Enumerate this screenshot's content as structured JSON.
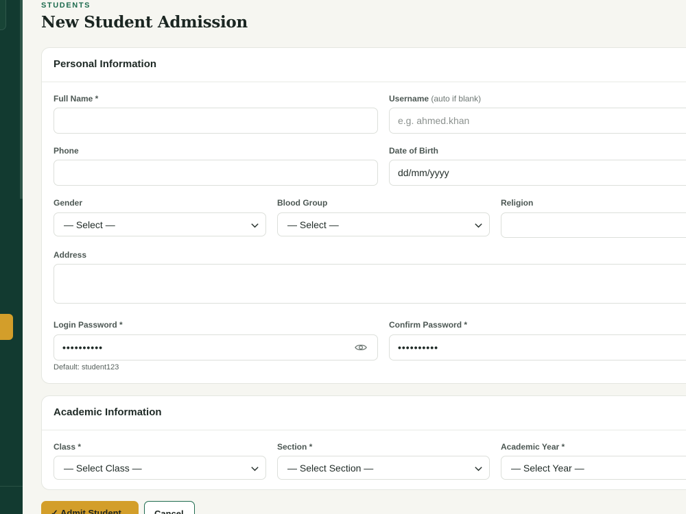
{
  "header": {
    "eyebrow": "STUDENTS",
    "title": "New Student Admission"
  },
  "personal": {
    "title": "Personal Information",
    "full_name": {
      "label": "Full Name *",
      "value": ""
    },
    "username": {
      "label": "Username",
      "hint": "(auto if blank)",
      "placeholder": "e.g. ahmed.khan"
    },
    "phone": {
      "label": "Phone",
      "value": ""
    },
    "dob": {
      "label": "Date of Birth",
      "value": "dd/mm/yyyy"
    },
    "gender": {
      "label": "Gender",
      "value": "— Select —"
    },
    "blood_group": {
      "label": "Blood Group",
      "value": "— Select —"
    },
    "religion": {
      "label": "Religion",
      "value": ""
    },
    "address": {
      "label": "Address",
      "value": ""
    },
    "login_password": {
      "label": "Login Password *",
      "value": "••••••••••",
      "help": "Default: student123"
    },
    "confirm_password": {
      "label": "Confirm Password *",
      "value": "••••••••••"
    }
  },
  "academic": {
    "title": "Academic Information",
    "class": {
      "label": "Class *",
      "value": "— Select Class —"
    },
    "section": {
      "label": "Section *",
      "value": "— Select Section —"
    },
    "academic_year": {
      "label": "Academic Year *",
      "value": "— Select Year —"
    }
  },
  "actions": {
    "admit_label": "✓ Admit Student",
    "cancel_label": "Cancel"
  },
  "icons": {
    "chevron": "chevron-down-icon",
    "eye": "eye-icon",
    "check": "check-icon"
  },
  "colors": {
    "sidebar": "#123a30",
    "accent": "#d39e2a",
    "brand_green": "#1d6b4e"
  }
}
